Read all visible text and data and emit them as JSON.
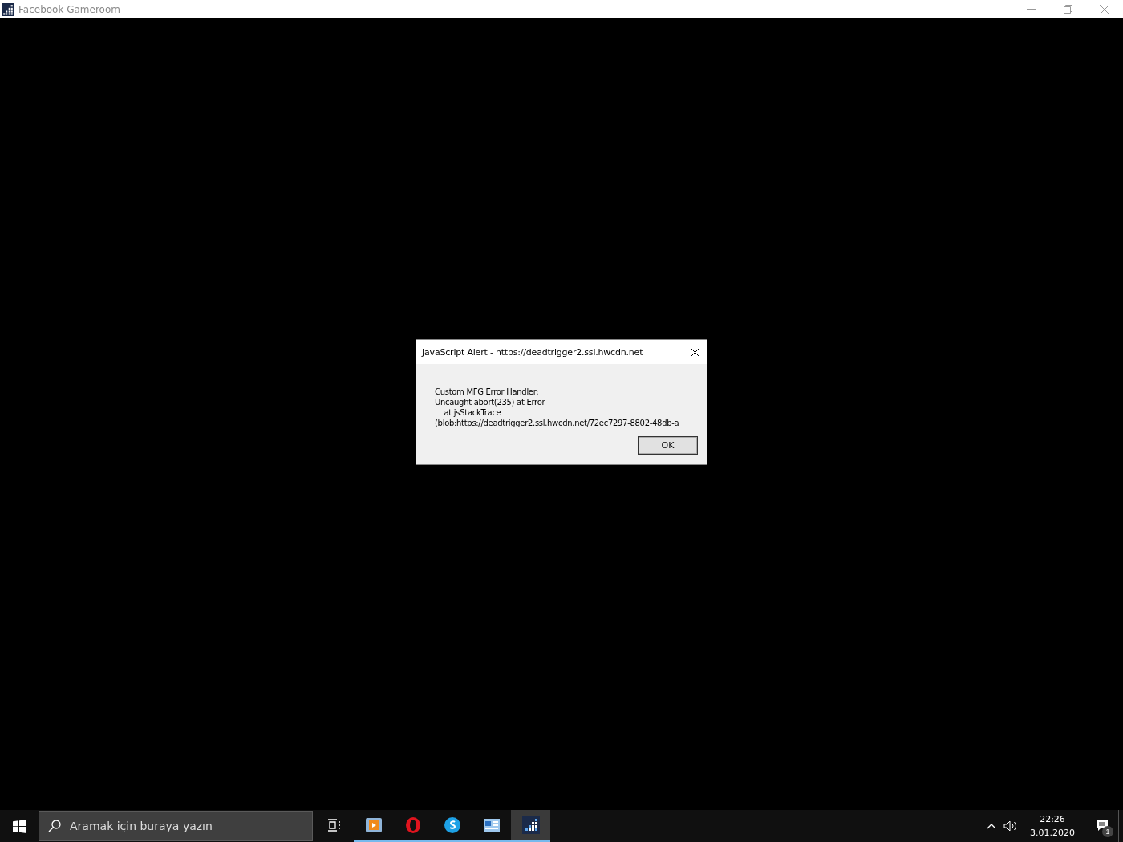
{
  "window": {
    "title": "Facebook Gameroom"
  },
  "dialog": {
    "title": "JavaScript Alert - https://deadtrigger2.ssl.hwcdn.net",
    "message_lines": [
      "Custom MFG Error Handler:",
      "Uncaught abort(235) at Error",
      "    at jsStackTrace",
      "(blob:https://deadtrigger2.ssl.hwcdn.net/72ec7297-8802-48db-a"
    ],
    "button": "OK"
  },
  "taskbar": {
    "search": {
      "placeholder": "Aramak için buraya yazın"
    },
    "apps": [
      {
        "kind": "media",
        "running": true,
        "selected": false
      },
      {
        "kind": "opera",
        "running": true,
        "selected": false
      },
      {
        "kind": "skype",
        "running": true,
        "selected": false
      },
      {
        "kind": "control",
        "running": true,
        "selected": false
      },
      {
        "kind": "gameroom",
        "running": true,
        "selected": true
      }
    ],
    "time": "22:26",
    "date": "3.01.2020",
    "notification_count": "1"
  }
}
